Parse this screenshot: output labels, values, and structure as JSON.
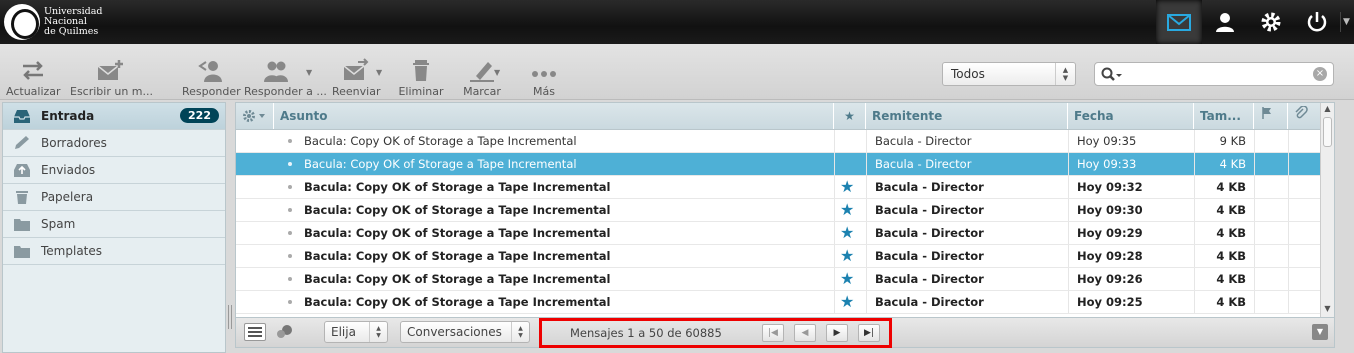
{
  "brand": {
    "line1": "Universidad",
    "line2": "Nacional",
    "line3": "de Quilmes"
  },
  "topnav": [
    {
      "icon": "mail-icon",
      "active": true
    },
    {
      "icon": "user-icon",
      "active": false
    },
    {
      "icon": "gear-icon",
      "active": false
    },
    {
      "icon": "power-icon",
      "active": false
    }
  ],
  "toolbar": {
    "refresh": "Actualizar",
    "compose": "Escribir un m...",
    "reply": "Responder",
    "reply_all": "Responder a ...",
    "forward": "Reenviar",
    "delete": "Eliminar",
    "mark": "Marcar",
    "more": "Más"
  },
  "filter": {
    "selected": "Todos"
  },
  "search": {
    "value": ""
  },
  "folders": [
    {
      "label": "Entrada",
      "icon": "inbox-icon",
      "count": "222",
      "active": true
    },
    {
      "label": "Borradores",
      "icon": "pencil-icon"
    },
    {
      "label": "Enviados",
      "icon": "sent-icon"
    },
    {
      "label": "Papelera",
      "icon": "trash-icon"
    },
    {
      "label": "Spam",
      "icon": "folder-icon"
    },
    {
      "label": "Templates",
      "icon": "folder-icon"
    }
  ],
  "columns": {
    "subject": "Asunto",
    "flagged": "★",
    "from": "Remitente",
    "date": "Fecha",
    "size": "Tam..."
  },
  "messages": [
    {
      "subject": "Bacula: Copy OK of Storage a Tape Incremental",
      "from": "Bacula - Director",
      "date": "Hoy 09:35",
      "size": "9 KB",
      "unread": false,
      "selected": false,
      "flagged": false
    },
    {
      "subject": "Bacula: Copy OK of Storage a Tape Incremental",
      "from": "Bacula - Director",
      "date": "Hoy 09:33",
      "size": "4 KB",
      "unread": false,
      "selected": true,
      "flagged": false
    },
    {
      "subject": "Bacula: Copy OK of Storage a Tape Incremental",
      "from": "Bacula - Director",
      "date": "Hoy 09:32",
      "size": "4 KB",
      "unread": true,
      "selected": false,
      "flagged": true
    },
    {
      "subject": "Bacula: Copy OK of Storage a Tape Incremental",
      "from": "Bacula - Director",
      "date": "Hoy 09:30",
      "size": "4 KB",
      "unread": true,
      "selected": false,
      "flagged": true
    },
    {
      "subject": "Bacula: Copy OK of Storage a Tape Incremental",
      "from": "Bacula - Director",
      "date": "Hoy 09:29",
      "size": "4 KB",
      "unread": true,
      "selected": false,
      "flagged": true
    },
    {
      "subject": "Bacula: Copy OK of Storage a Tape Incremental",
      "from": "Bacula - Director",
      "date": "Hoy 09:28",
      "size": "4 KB",
      "unread": true,
      "selected": false,
      "flagged": true
    },
    {
      "subject": "Bacula: Copy OK of Storage a Tape Incremental",
      "from": "Bacula - Director",
      "date": "Hoy 09:26",
      "size": "4 KB",
      "unread": true,
      "selected": false,
      "flagged": true
    },
    {
      "subject": "Bacula: Copy OK of Storage a Tape Incremental",
      "from": "Bacula - Director",
      "date": "Hoy 09:25",
      "size": "4 KB",
      "unread": true,
      "selected": false,
      "flagged": true
    }
  ],
  "footer": {
    "select": "Elija",
    "threads": "Conversaciones",
    "count_text": "Mensajes 1 a 50 de 60885"
  },
  "colors": {
    "accent": "#4eb0d6",
    "badge": "#004458",
    "highlight_border": "#e00000"
  }
}
